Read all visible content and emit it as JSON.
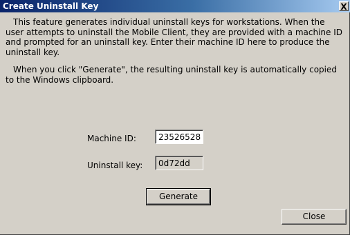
{
  "window": {
    "title": "Create Uninstall Key",
    "close_glyph": "X"
  },
  "text": {
    "description": "This feature generates individual uninstall keys for workstations.  When the user attempts to uninstall the Mobile Client, they are provided with a machine ID and prompted for an uninstall key.  Enter their machine ID here to produce the uninstall key.",
    "clipboard_note": "When you click \"Generate\", the resulting uninstall key is automatically copied to the Windows clipboard."
  },
  "form": {
    "machine_id_label": "Machine ID:",
    "machine_id_value": "23526528",
    "uninstall_key_label": "Uninstall key:",
    "uninstall_key_value": "0d72dd"
  },
  "buttons": {
    "generate": "Generate",
    "close": "Close"
  }
}
